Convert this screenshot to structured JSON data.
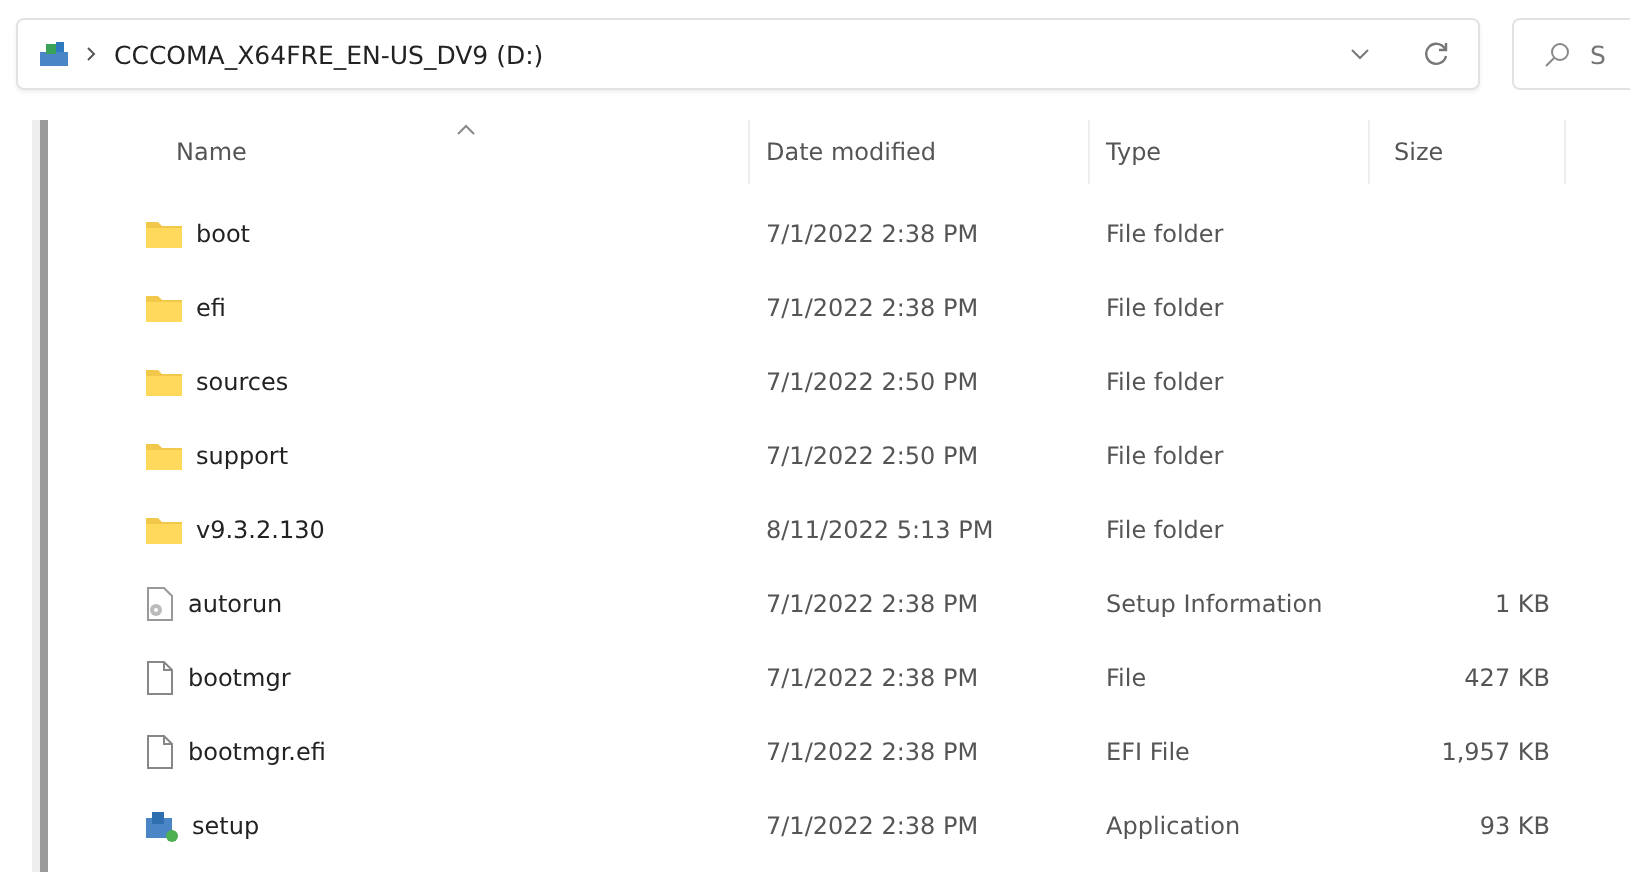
{
  "address_bar": {
    "path": "CCCOMA_X64FRE_EN-US_DV9 (D:)"
  },
  "search": {
    "placeholder": "S"
  },
  "table": {
    "columns": [
      {
        "label": "Name",
        "sorted": true
      },
      {
        "label": "Date modified",
        "sorted": false
      },
      {
        "label": "Type",
        "sorted": false
      },
      {
        "label": "Size",
        "sorted": false
      }
    ],
    "rows": [
      {
        "kind": "folder",
        "name": "boot",
        "date": "7/1/2022 2:38 PM",
        "type": "File folder",
        "size": ""
      },
      {
        "kind": "folder",
        "name": "efi",
        "date": "7/1/2022 2:38 PM",
        "type": "File folder",
        "size": ""
      },
      {
        "kind": "folder",
        "name": "sources",
        "date": "7/1/2022 2:50 PM",
        "type": "File folder",
        "size": ""
      },
      {
        "kind": "folder",
        "name": "support",
        "date": "7/1/2022 2:50 PM",
        "type": "File folder",
        "size": ""
      },
      {
        "kind": "folder",
        "name": "v9.3.2.130",
        "date": "8/11/2022 5:13 PM",
        "type": "File folder",
        "size": ""
      },
      {
        "kind": "settings",
        "name": "autorun",
        "date": "7/1/2022 2:38 PM",
        "type": "Setup Information",
        "size": "1 KB"
      },
      {
        "kind": "file",
        "name": "bootmgr",
        "date": "7/1/2022 2:38 PM",
        "type": "File",
        "size": "427 KB"
      },
      {
        "kind": "file",
        "name": "bootmgr.efi",
        "date": "7/1/2022 2:38 PM",
        "type": "EFI File",
        "size": "1,957 KB"
      },
      {
        "kind": "app",
        "name": "setup",
        "date": "7/1/2022 2:38 PM",
        "type": "Application",
        "size": "93 KB"
      }
    ]
  }
}
